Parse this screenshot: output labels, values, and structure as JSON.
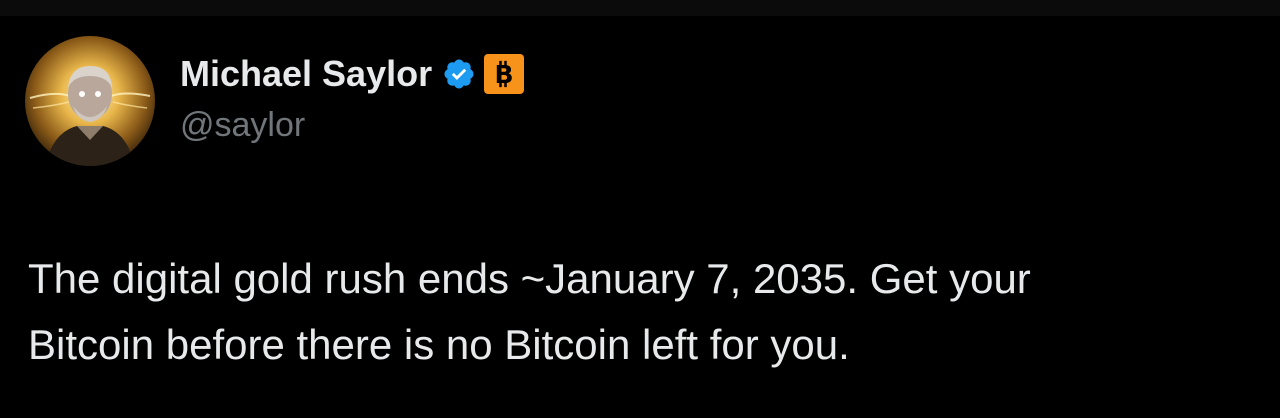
{
  "author": {
    "display_name": "Michael Saylor",
    "handle": "@saylor",
    "verified": true,
    "affiliate_badge": "bitcoin-icon"
  },
  "tweet": {
    "text_lines": [
      "The digital gold rush ends ~January 7, 2035. Get your",
      "Bitcoin before there is no Bitcoin left for you."
    ]
  },
  "colors": {
    "background": "#000000",
    "primary_text": "#e7e9ea",
    "secondary_text": "#71767b",
    "verified_blue": "#1d9bf0",
    "bitcoin_orange": "#f7931a"
  }
}
